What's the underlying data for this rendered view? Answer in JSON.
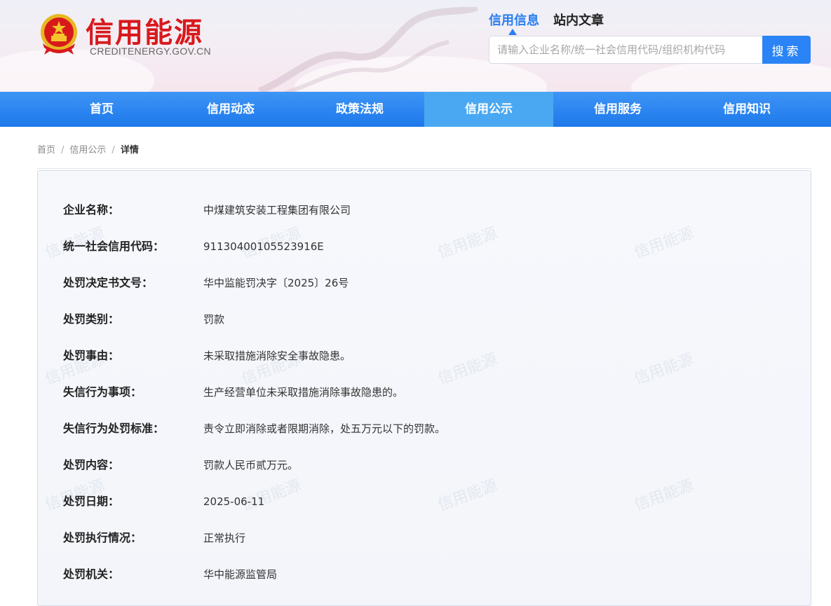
{
  "header": {
    "site_name_cn": "信用能源",
    "site_domain": "CREDITENERGY.GOV.CN",
    "search_tabs": [
      {
        "label": "信用信息",
        "active": true
      },
      {
        "label": "站内文章",
        "active": false
      }
    ],
    "search_placeholder": "请输入企业名称/统一社会信用代码/组织机构代码",
    "search_button": "搜索",
    "brand_red": "#d8191c",
    "accent_blue": "#2a84f5"
  },
  "nav": {
    "items": [
      {
        "label": "首页",
        "active": false
      },
      {
        "label": "信用动态",
        "active": false
      },
      {
        "label": "政策法规",
        "active": false
      },
      {
        "label": "信用公示",
        "active": true
      },
      {
        "label": "信用服务",
        "active": false
      },
      {
        "label": "信用知识",
        "active": false
      }
    ]
  },
  "breadcrumb": {
    "items": [
      "首页",
      "信用公示"
    ],
    "separator": "/",
    "current": "详情"
  },
  "watermark_text": "信用能源",
  "detail": {
    "rows": [
      {
        "label": "企业名称：",
        "value": "中煤建筑安装工程集团有限公司"
      },
      {
        "label": "统一社会信用代码：",
        "value": "91130400105523916E"
      },
      {
        "label": "处罚决定书文号：",
        "value": "华中监能罚决字〔2025〕26号"
      },
      {
        "label": "处罚类别：",
        "value": "罚款"
      },
      {
        "label": "处罚事由：",
        "value": "未采取措施消除安全事故隐患。"
      },
      {
        "label": "失信行为事项：",
        "value": "生产经营单位未采取措施消除事故隐患的。"
      },
      {
        "label": "失信行为处罚标准：",
        "value": "责令立即消除或者限期消除，处五万元以下的罚款。"
      },
      {
        "label": "处罚内容：",
        "value": "罚款人民币贰万元。"
      },
      {
        "label": "处罚日期：",
        "value": "2025-06-11"
      },
      {
        "label": "处罚执行情况：",
        "value": "正常执行"
      },
      {
        "label": "处罚机关：",
        "value": "华中能源监管局"
      }
    ]
  }
}
